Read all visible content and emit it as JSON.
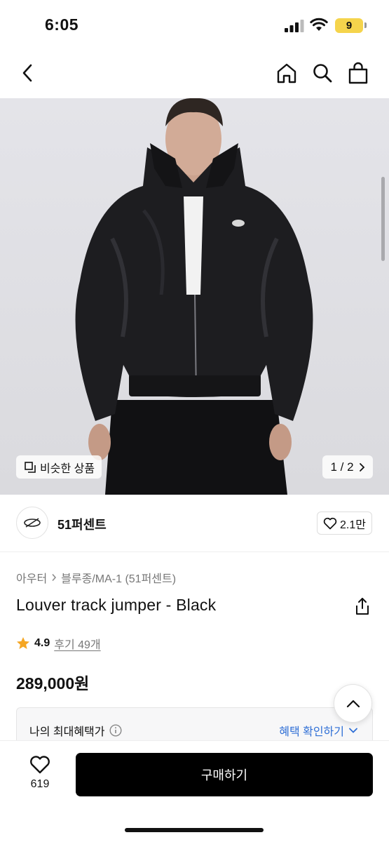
{
  "status_bar": {
    "time": "6:05",
    "battery": "9"
  },
  "header": {
    "back_icon": "chevron-left-icon",
    "home_icon": "home-icon",
    "search_icon": "search-icon",
    "cart_icon": "shopping-bag-icon"
  },
  "gallery": {
    "similar_label": "비슷한 상품",
    "page_indicator": "1 / 2",
    "current_page": 1,
    "total_pages": 2
  },
  "brand": {
    "name": "51퍼센트",
    "likes": "2.1만"
  },
  "breadcrumb": {
    "category": "아우터",
    "subcategory": "블루종/MA-1 (51퍼센트)"
  },
  "product": {
    "title": "Louver track jumper - Black",
    "rating": "4.9",
    "reviews": "후기 49개",
    "price": "289,000원"
  },
  "benefit": {
    "label": "나의 최대혜택가",
    "link": "혜택 확인하기"
  },
  "bottom_bar": {
    "wish_count": "619",
    "buy_label": "구매하기"
  },
  "colors": {
    "accent_blue": "#2f6fd6",
    "star": "#f5a623",
    "buy_button": "#000000",
    "battery": "#f5d44c"
  }
}
